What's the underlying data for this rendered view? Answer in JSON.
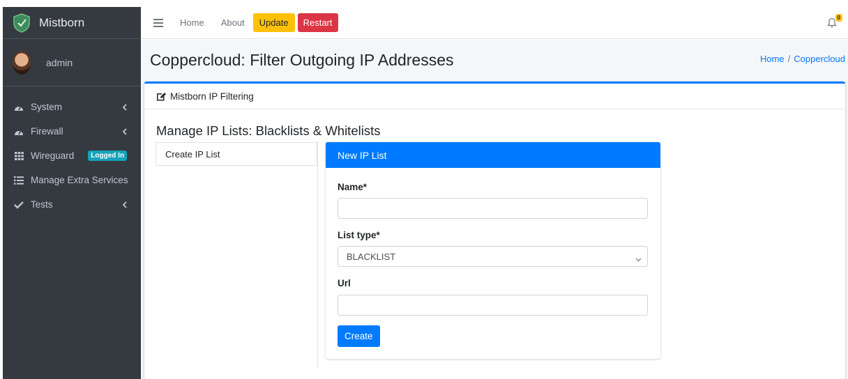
{
  "app": {
    "brand": "Mistborn",
    "user": "admin"
  },
  "sidebar": {
    "items": [
      {
        "label": "System",
        "icon": "dashboard-icon",
        "has_chevron": true
      },
      {
        "label": "Firewall",
        "icon": "dashboard-icon",
        "has_chevron": true
      },
      {
        "label": "Wireguard",
        "icon": "grid-icon",
        "badge": "Logged In"
      },
      {
        "label": "Manage Extra Services",
        "icon": "list-icon"
      },
      {
        "label": "Tests",
        "icon": "check-icon",
        "has_chevron": true
      }
    ]
  },
  "topbar": {
    "links": [
      "Home",
      "About"
    ],
    "update_label": "Update",
    "restart_label": "Restart",
    "notification_count": "0"
  },
  "page": {
    "title": "Coppercloud: Filter Outgoing IP Addresses",
    "breadcrumb": [
      "Home",
      "Coppercloud"
    ]
  },
  "card": {
    "header": "Mistborn IP Filtering",
    "subtitle": "Manage IP Lists: Blacklists & Whitelists"
  },
  "list": {
    "items": [
      "Create IP List"
    ]
  },
  "form": {
    "title": "New IP List",
    "name_label": "Name*",
    "name_value": "",
    "type_label": "List type*",
    "type_value": "BLACKLIST",
    "url_label": "Url",
    "url_value": "",
    "create_label": "Create"
  },
  "colors": {
    "sidebar_bg": "#343a40",
    "primary": "#007bff",
    "warning": "#ffc107",
    "danger": "#dc3545",
    "info": "#17a2b8",
    "content_bg": "#f4f6f9"
  }
}
